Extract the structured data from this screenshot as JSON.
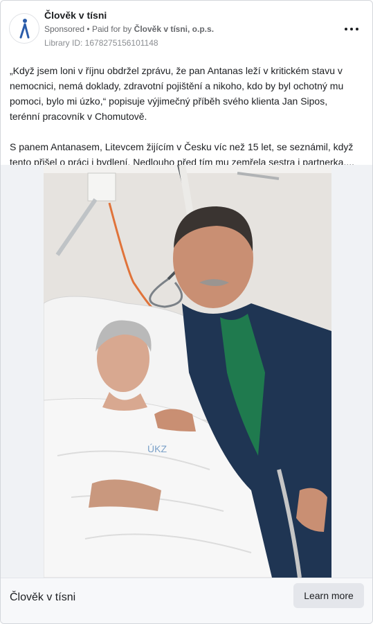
{
  "advertiser": {
    "name": "Člověk v tísni",
    "sponsored_label": "Sponsored",
    "paid_for_prefix": "Paid for by",
    "paid_for_by": "Člověk v tísni, o.p.s.",
    "library_id": "Library ID: 1678275156101148",
    "logo_icon": "clovek-v-tisni-logo-icon",
    "logo_color": "#2a5caa"
  },
  "menu": {
    "icon": "more-options-icon"
  },
  "post": {
    "paragraphs": [
      "„Když jsem loni v říjnu obdržel zprávu, že pan Antanas leží v kritickém stavu v nemocnici, nemá doklady, zdravotní pojištění a nikoho, kdo by byl ochotný mu pomoci, bylo mi úzko,“ popisuje výjimečný příběh svého klienta Jan Sipos, terénní pracovník v Chomutově.",
      "S panem Antanasem, Litevcem žijícím v Česku víc než 15 let, se seznámil, když tento přišel o práci i bydlení. Nedlouho před tím mu zemřela sestra i partnerka...."
    ]
  },
  "image": {
    "blanket_print": "ÚKZ"
  },
  "footer": {
    "title": "Člověk v tísni",
    "cta_label": "Learn more"
  }
}
